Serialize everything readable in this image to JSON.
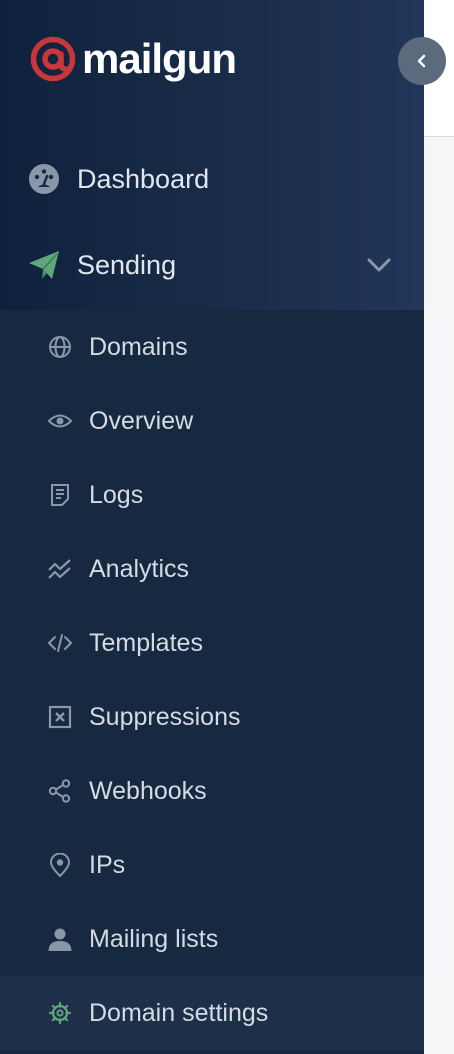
{
  "brand": {
    "name": "mailgun",
    "accent": "#c9363b"
  },
  "sidebar": {
    "collapse_icon": "chevron-left",
    "top_items": [
      {
        "label": "Dashboard",
        "icon": "dashboard-gauge"
      },
      {
        "label": "Sending",
        "icon": "paper-plane",
        "expanded": true
      }
    ],
    "sending_items": [
      {
        "label": "Domains",
        "icon": "globe"
      },
      {
        "label": "Overview",
        "icon": "eye"
      },
      {
        "label": "Logs",
        "icon": "document"
      },
      {
        "label": "Analytics",
        "icon": "trend-chart"
      },
      {
        "label": "Templates",
        "icon": "code"
      },
      {
        "label": "Suppressions",
        "icon": "x-square"
      },
      {
        "label": "Webhooks",
        "icon": "share-nodes"
      },
      {
        "label": "IPs",
        "icon": "location-pin"
      },
      {
        "label": "Mailing lists",
        "icon": "user"
      },
      {
        "label": "Domain settings",
        "icon": "gear",
        "active": true
      }
    ]
  },
  "colors": {
    "sidebar_bg": "#172841",
    "text": "#d5dbe4",
    "icon": "#8a97a8",
    "sending_icon": "#5fa77b",
    "active_icon": "#5fa77b"
  }
}
